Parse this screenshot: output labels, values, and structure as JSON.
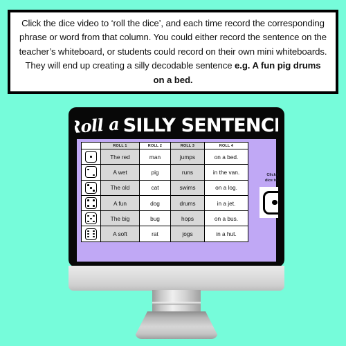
{
  "instruction": {
    "text_before_bold": "Click the dice video to ‘roll the dice’, and each time record the corresponding phrase or word from that column. You could either record the sentence on the teacher’s whiteboard, or students could record on their own mini whiteboards. They will end up creating a silly decodable sentence ",
    "bold_example": "e.g. A fun pig drums on a bed."
  },
  "slide": {
    "title_script": "Roll a",
    "title_main": "SILLY SENTENCE",
    "background_color": "#c0a8f5",
    "page_background_color": "#76fcda"
  },
  "table": {
    "headers": [
      "",
      "ROLL 1",
      "ROLL 2",
      "ROLL 3",
      "ROLL 4"
    ],
    "rows": [
      {
        "die": 1,
        "die_name": "die-face-1",
        "cells": [
          "The red",
          "man",
          "jumps",
          "on a bed."
        ]
      },
      {
        "die": 2,
        "die_name": "die-face-2",
        "cells": [
          "A wet",
          "pig",
          "runs",
          "in the van."
        ]
      },
      {
        "die": 3,
        "die_name": "die-face-3",
        "cells": [
          "The old",
          "cat",
          "swims",
          "on a log."
        ]
      },
      {
        "die": 4,
        "die_name": "die-face-4",
        "cells": [
          "A fun",
          "dog",
          "drums",
          "in a jet."
        ]
      },
      {
        "die": 5,
        "die_name": "die-face-5",
        "cells": [
          "The big",
          "bug",
          "hops",
          "on a bus."
        ]
      },
      {
        "die": 6,
        "die_name": "die-face-6",
        "cells": [
          "A soft",
          "rat",
          "jogs",
          "in a hut."
        ]
      }
    ]
  },
  "dice_widget": {
    "caption": "Click the\ndice to roll",
    "current_face": 1,
    "icon": "die-face-1"
  }
}
